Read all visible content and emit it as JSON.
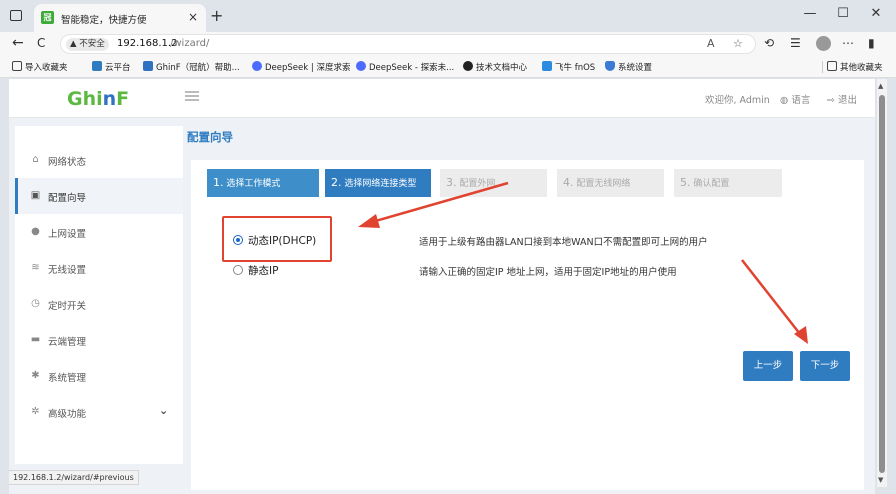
{
  "browser": {
    "tab_title": "智能稳定，快捷方便",
    "tab_favicon_text": "冠",
    "new_tab": "+",
    "tab_close": "×",
    "window_controls": {
      "minimize": "—",
      "maximize": "☐",
      "close": "✕"
    },
    "nav": {
      "back": "←",
      "refresh": "C",
      "home": "⌂"
    },
    "url_warning": "▲ 不安全",
    "url_host": "192.168.1.2",
    "url_path": "/wizard/",
    "bookmarks": [
      {
        "label": "导入收藏夹",
        "icon": "import-icon",
        "color": "#444444"
      },
      {
        "label": "云平台",
        "icon": "grid-icon",
        "color": "#2f7cc1"
      },
      {
        "label": "GhinF（冠航）帮助...",
        "icon": "ghinf-icon",
        "color": "#2f72c2"
      },
      {
        "label": "DeepSeek | 深度求索",
        "icon": "deepseek-icon",
        "color": "#4d6bfe"
      },
      {
        "label": "DeepSeek - 探索未...",
        "icon": "deepseek-icon",
        "color": "#4d6bfe"
      },
      {
        "label": "技术文档中心",
        "icon": "github-icon",
        "color": "#222222"
      },
      {
        "label": "飞牛 fnOS",
        "icon": "fnos-icon",
        "color": "#2a8be0"
      },
      {
        "label": "系统设置",
        "icon": "shield-icon",
        "color": "#3a7bd5"
      }
    ],
    "other_bookmarks": "其他收藏夹"
  },
  "header": {
    "logo_g": "Ghi",
    "logo_n": "n",
    "logo_f": "F",
    "welcome": "欢迎你, Admin",
    "language": "语言",
    "logout": "退出"
  },
  "sidebar": {
    "items": [
      {
        "label": "网络状态",
        "icon": "home-icon"
      },
      {
        "label": "配置向导",
        "icon": "wizard-icon"
      },
      {
        "label": "上网设置",
        "icon": "globe-icon"
      },
      {
        "label": "无线设置",
        "icon": "wifi-icon"
      },
      {
        "label": "定时开关",
        "icon": "clock-icon"
      },
      {
        "label": "云端管理",
        "icon": "cloud-icon"
      },
      {
        "label": "系统管理",
        "icon": "gear-icon"
      },
      {
        "label": "高级功能",
        "icon": "gears-icon"
      }
    ],
    "active_index": 1
  },
  "page_title": "配置向导",
  "steps": [
    {
      "num": "1.",
      "label": "选择工作模式",
      "state": "done"
    },
    {
      "num": "2.",
      "label": "选择网络连接类型",
      "state": "current"
    },
    {
      "num": "3.",
      "label": "配置外网",
      "state": "pending"
    },
    {
      "num": "4.",
      "label": "配置无线网络",
      "state": "pending"
    },
    {
      "num": "5.",
      "label": "确认配置",
      "state": "pending"
    }
  ],
  "options": [
    {
      "label": "动态IP(DHCP)",
      "description": "适用于上级有路由器LAN口接到本地WAN口不需配置即可上网的用户",
      "checked": true
    },
    {
      "label": "静态IP",
      "description": "请输入正确的固定IP 地址上网，适用于固定IP地址的用户使用",
      "checked": false
    }
  ],
  "buttons": {
    "prev": "上一步",
    "next": "下一步"
  },
  "status_url": "192.168.1.2/wizard/#previous",
  "colors": {
    "primary": "#2f7cc1",
    "logo_green": "#5bb840",
    "annotation_red": "#e0432f"
  }
}
